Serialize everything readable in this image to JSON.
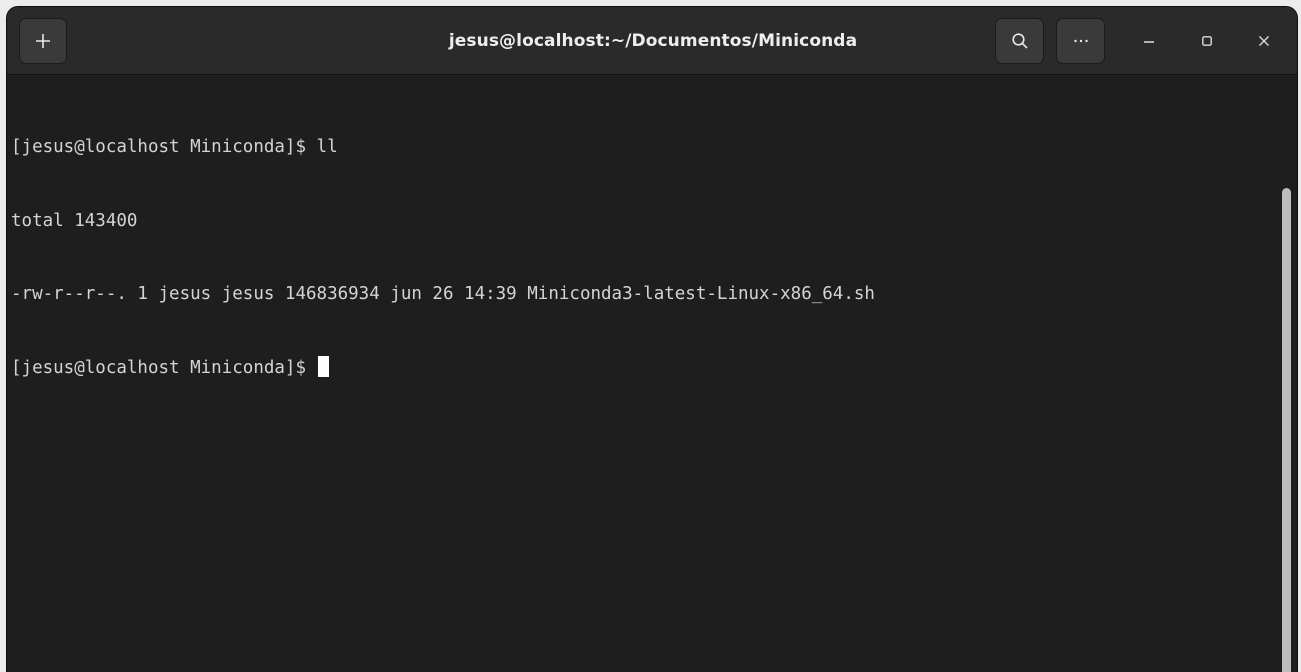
{
  "window": {
    "title": "jesus@localhost:~/Documentos/Miniconda"
  },
  "headerbar": {
    "new_tab_icon": "plus-icon",
    "search_icon": "search-icon",
    "menu_icon": "more-horizontal-icon",
    "minimize_icon": "minimize-icon",
    "maximize_icon": "maximize-icon",
    "close_icon": "close-icon"
  },
  "terminal": {
    "lines": [
      "[jesus@localhost Miniconda]$ ll",
      "total 143400",
      "-rw-r--r--. 1 jesus jesus 146836934 jun 26 14:39 Miniconda3-latest-Linux-x86_64.sh",
      "[jesus@localhost Miniconda]$ "
    ]
  },
  "colors": {
    "background": "#1e1e1e",
    "headerbar": "#2a2a2a",
    "text": "#d4d4d4",
    "cursor": "#ffffff"
  }
}
